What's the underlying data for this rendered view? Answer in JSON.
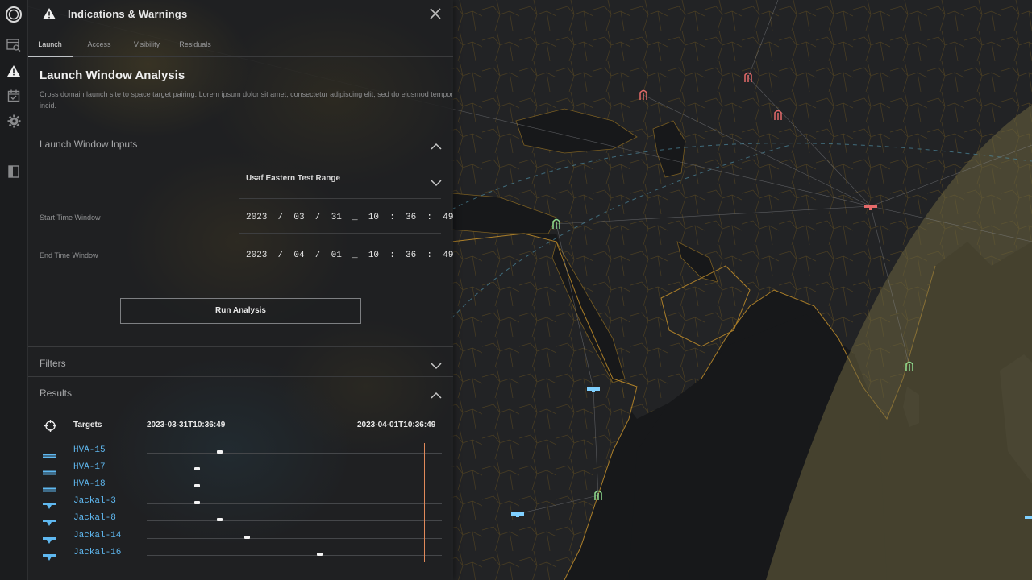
{
  "header": {
    "title": "Indications & Warnings",
    "warn_icon": "warning-triangle-icon",
    "close_icon": "close-icon"
  },
  "rail": {
    "items": [
      "globe-icon",
      "search-list-icon",
      "warning-icon",
      "calendar-check-icon",
      "gear-icon",
      "book-icon"
    ],
    "active": "warning-icon"
  },
  "tabs": [
    {
      "label": "Launch",
      "active": true
    },
    {
      "label": "Access",
      "active": false
    },
    {
      "label": "Visibility",
      "active": false
    },
    {
      "label": "Residuals",
      "active": false
    }
  ],
  "section": {
    "title": "Launch Window Analysis",
    "description": "Cross domain launch site to space target pairing. Lorem ipsum dolor sit amet, consectetur adipiscing elit, sed do eiusmod tempor incid."
  },
  "inputs": {
    "heading": "Launch Window Inputs",
    "site": "Usaf Eastern Test Range",
    "start_label": "Start Time Window",
    "start_value": "2023  /  03  /  31  _  10  :  36  :  49",
    "end_label": "End Time Window",
    "end_value": "2023  /  04  /  01  _  10  :  36  :  49",
    "run_label": "Run Analysis"
  },
  "filters": {
    "heading": "Filters"
  },
  "results": {
    "heading": "Results",
    "targets_label": "Targets",
    "start": "2023-03-31T10:36:49",
    "end": "2023-04-01T10:36:49",
    "targets": [
      {
        "name": "HVA-15",
        "type": "hva",
        "window": 0.245
      },
      {
        "name": "HVA-17",
        "type": "hva",
        "window": 0.17
      },
      {
        "name": "HVA-18",
        "type": "hva",
        "window": 0.17
      },
      {
        "name": "Jackal-3",
        "type": "jackal",
        "window": 0.17
      },
      {
        "name": "Jackal-8",
        "type": "jackal",
        "window": 0.245
      },
      {
        "name": "Jackal-14",
        "type": "jackal",
        "window": 0.34
      },
      {
        "name": "Jackal-16",
        "type": "jackal",
        "window": 0.585
      }
    ],
    "now_fraction": 0.94
  },
  "colors": {
    "accent_blue": "#5fb8f0",
    "now_line": "#e0895a",
    "site_green": "#8fdc8f",
    "site_red": "#e56a6a",
    "border_orange": "#b58a2a"
  }
}
